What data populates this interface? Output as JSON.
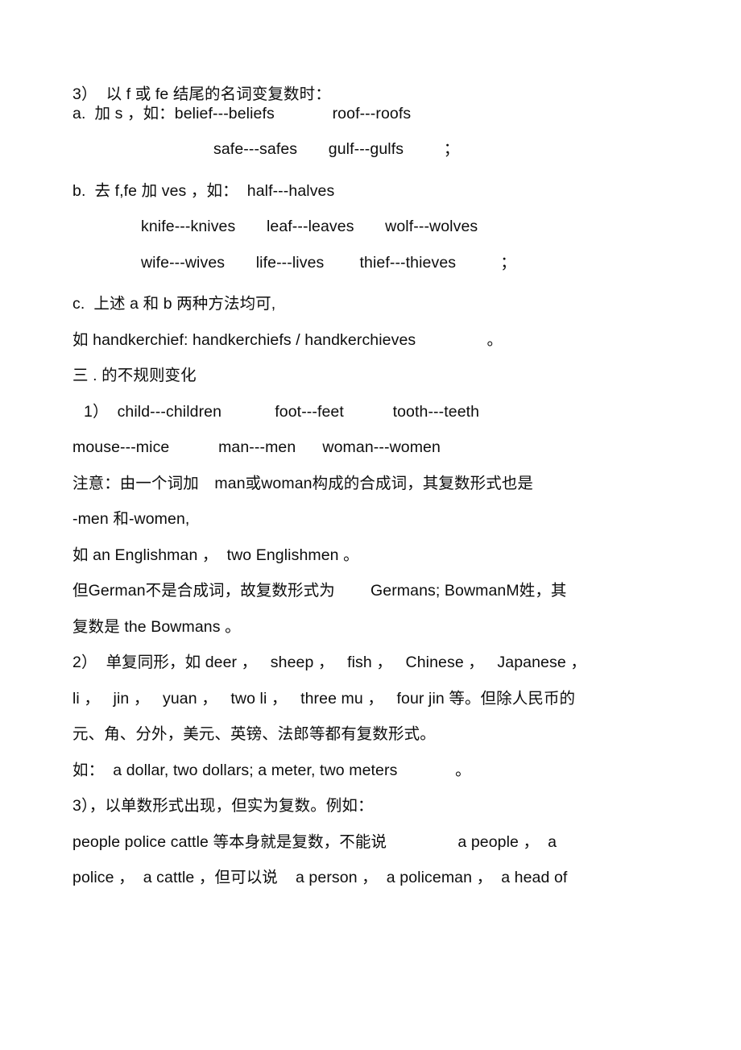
{
  "document": {
    "lines": [
      {
        "id": "l1",
        "text": "3）  以 f 或 fe 结尾的名词变复数时："
      },
      {
        "id": "l2",
        "text": "a.  加 s ，如：belief---beliefs             roof---roofs"
      },
      {
        "id": "l3",
        "text": "safe---safes       gulf---gulfs         ；"
      },
      {
        "id": "l4",
        "text": "b.  去 f,fe 加 ves ，如：  half---halves"
      },
      {
        "id": "l5",
        "text": "knife---knives       leaf---leaves       wolf---wolves"
      },
      {
        "id": "l6",
        "text": "wife---wives       life---lives        thief---thieves          ；"
      },
      {
        "id": "l7",
        "text": "c.  上述 a 和 b 两种方法均可,"
      },
      {
        "id": "l8",
        "text": "如 handkerchief: handkerchiefs / handkerchieves                。"
      },
      {
        "id": "l9",
        "text": "三 . 的不规则变化"
      },
      {
        "id": "l10",
        "text": "1）  child---children            foot---feet           tooth---teeth"
      },
      {
        "id": "l11",
        "text": "mouse---mice           man---men      woman---women"
      },
      {
        "id": "l12",
        "text": "注意：由一个词加　man或woman构成的合成词，其复数形式也是"
      },
      {
        "id": "l13",
        "text": "-men 和-women,"
      },
      {
        "id": "l14",
        "text": "如 an Englishman ，  two Englishmen 。"
      },
      {
        "id": "l15",
        "text": "但German不是合成词，故复数形式为        Germans; BowmanM姓，其"
      },
      {
        "id": "l16",
        "text": "复数是 the Bowmans 。"
      },
      {
        "id": "l17",
        "text": "2）  单复同形，如 deer ，   sheep ，   fish ，   Chinese ，   Japanese ，"
      },
      {
        "id": "l18",
        "text": "li ，   jin ，   yuan ，   two li ，   three mu ，   four jin 等。但除人民币的"
      },
      {
        "id": "l19",
        "text": "元、角、分外，美元、英镑、法郎等都有复数形式。"
      },
      {
        "id": "l20",
        "text": "如：  a dollar, two dollars; a meter, two meters             。"
      },
      {
        "id": "l21",
        "text": "3），以单数形式出现，但实为复数。例如："
      },
      {
        "id": "l22",
        "text": "people police cattle 等本身就是复数，不能说                a people ，  a"
      },
      {
        "id": "l23",
        "text": "police ，  a cattle ，但可以说    a person ，  a policeman ，  a head of"
      }
    ]
  }
}
